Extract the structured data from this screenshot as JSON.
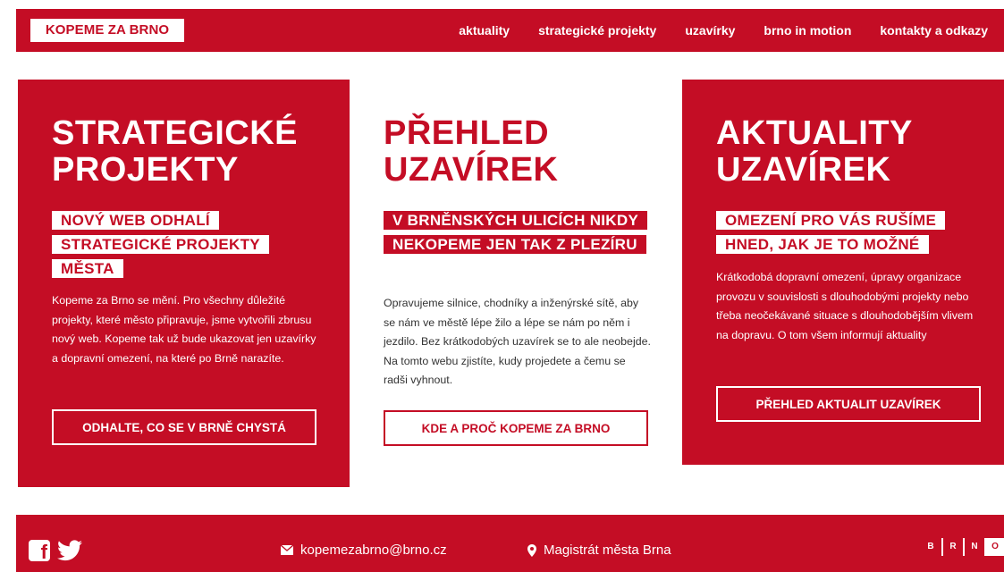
{
  "header": {
    "logo": "KOPEME ZA BRNO",
    "nav": [
      "aktuality",
      "strategické projekty",
      "uzavírky",
      "brno in motion",
      "kontakty a odkazy"
    ]
  },
  "cards": [
    {
      "title_lines": [
        "STRATEGICKÉ",
        "PROJEKTY"
      ],
      "highlight": "NOVÝ WEB ODHALÍ STRATEGICKÉ PROJEKTY MĚSTA",
      "text": "Kopeme za Brno se mění. Pro všechny důležité projekty, které město připravuje, jsme vytvořili zbrusu nový web. Kopeme tak už bude ukazovat jen uzavírky a dopravní omezení, na které po Brně narazíte.",
      "button": "ODHALTE, CO SE V BRNĚ CHYSTÁ"
    },
    {
      "title_lines": [
        "PŘEHLED",
        "UZAVÍREK"
      ],
      "highlight": "V BRNĚNSKÝCH ULICÍCH NIKDY NEKOPEME JEN TAK Z PLEZÍRU",
      "text": "Opravujeme silnice, chodníky a inženýrské sítě, aby se nám ve městě lépe žilo a lépe se nám po něm i jezdilo. Bez krátkodobých uzavírek se to ale neobejde. Na tomto webu zjistíte, kudy projedete a čemu se radši vyhnout.",
      "button": "KDE A PROČ KOPEME ZA BRNO"
    },
    {
      "title_lines": [
        "AKTUALITY",
        "UZAVÍREK"
      ],
      "highlight": "OMEZENÍ PRO VÁS RUŠÍME HNED, JAK JE TO MOŽNÉ",
      "text": "Krátkodobá dopravní omezení, úpravy organizace provozu v souvislosti s dlouhodobými projekty nebo třeba neočekávané situace s dlouhodobějším vlivem na dopravu. O tom všem informují aktuality",
      "button": "PŘEHLED AKTUALIT UZAVÍREK"
    }
  ],
  "footer": {
    "email": "kopemezabrno@brno.cz",
    "address": "Magistrát města Brna",
    "brand_letters": [
      "B",
      "R",
      "N",
      "O"
    ]
  },
  "icons": {
    "facebook": "facebook-icon",
    "twitter": "twitter-icon",
    "email": "envelope-icon",
    "location": "map-pin-icon"
  },
  "colors": {
    "accent": "#c40d25"
  }
}
